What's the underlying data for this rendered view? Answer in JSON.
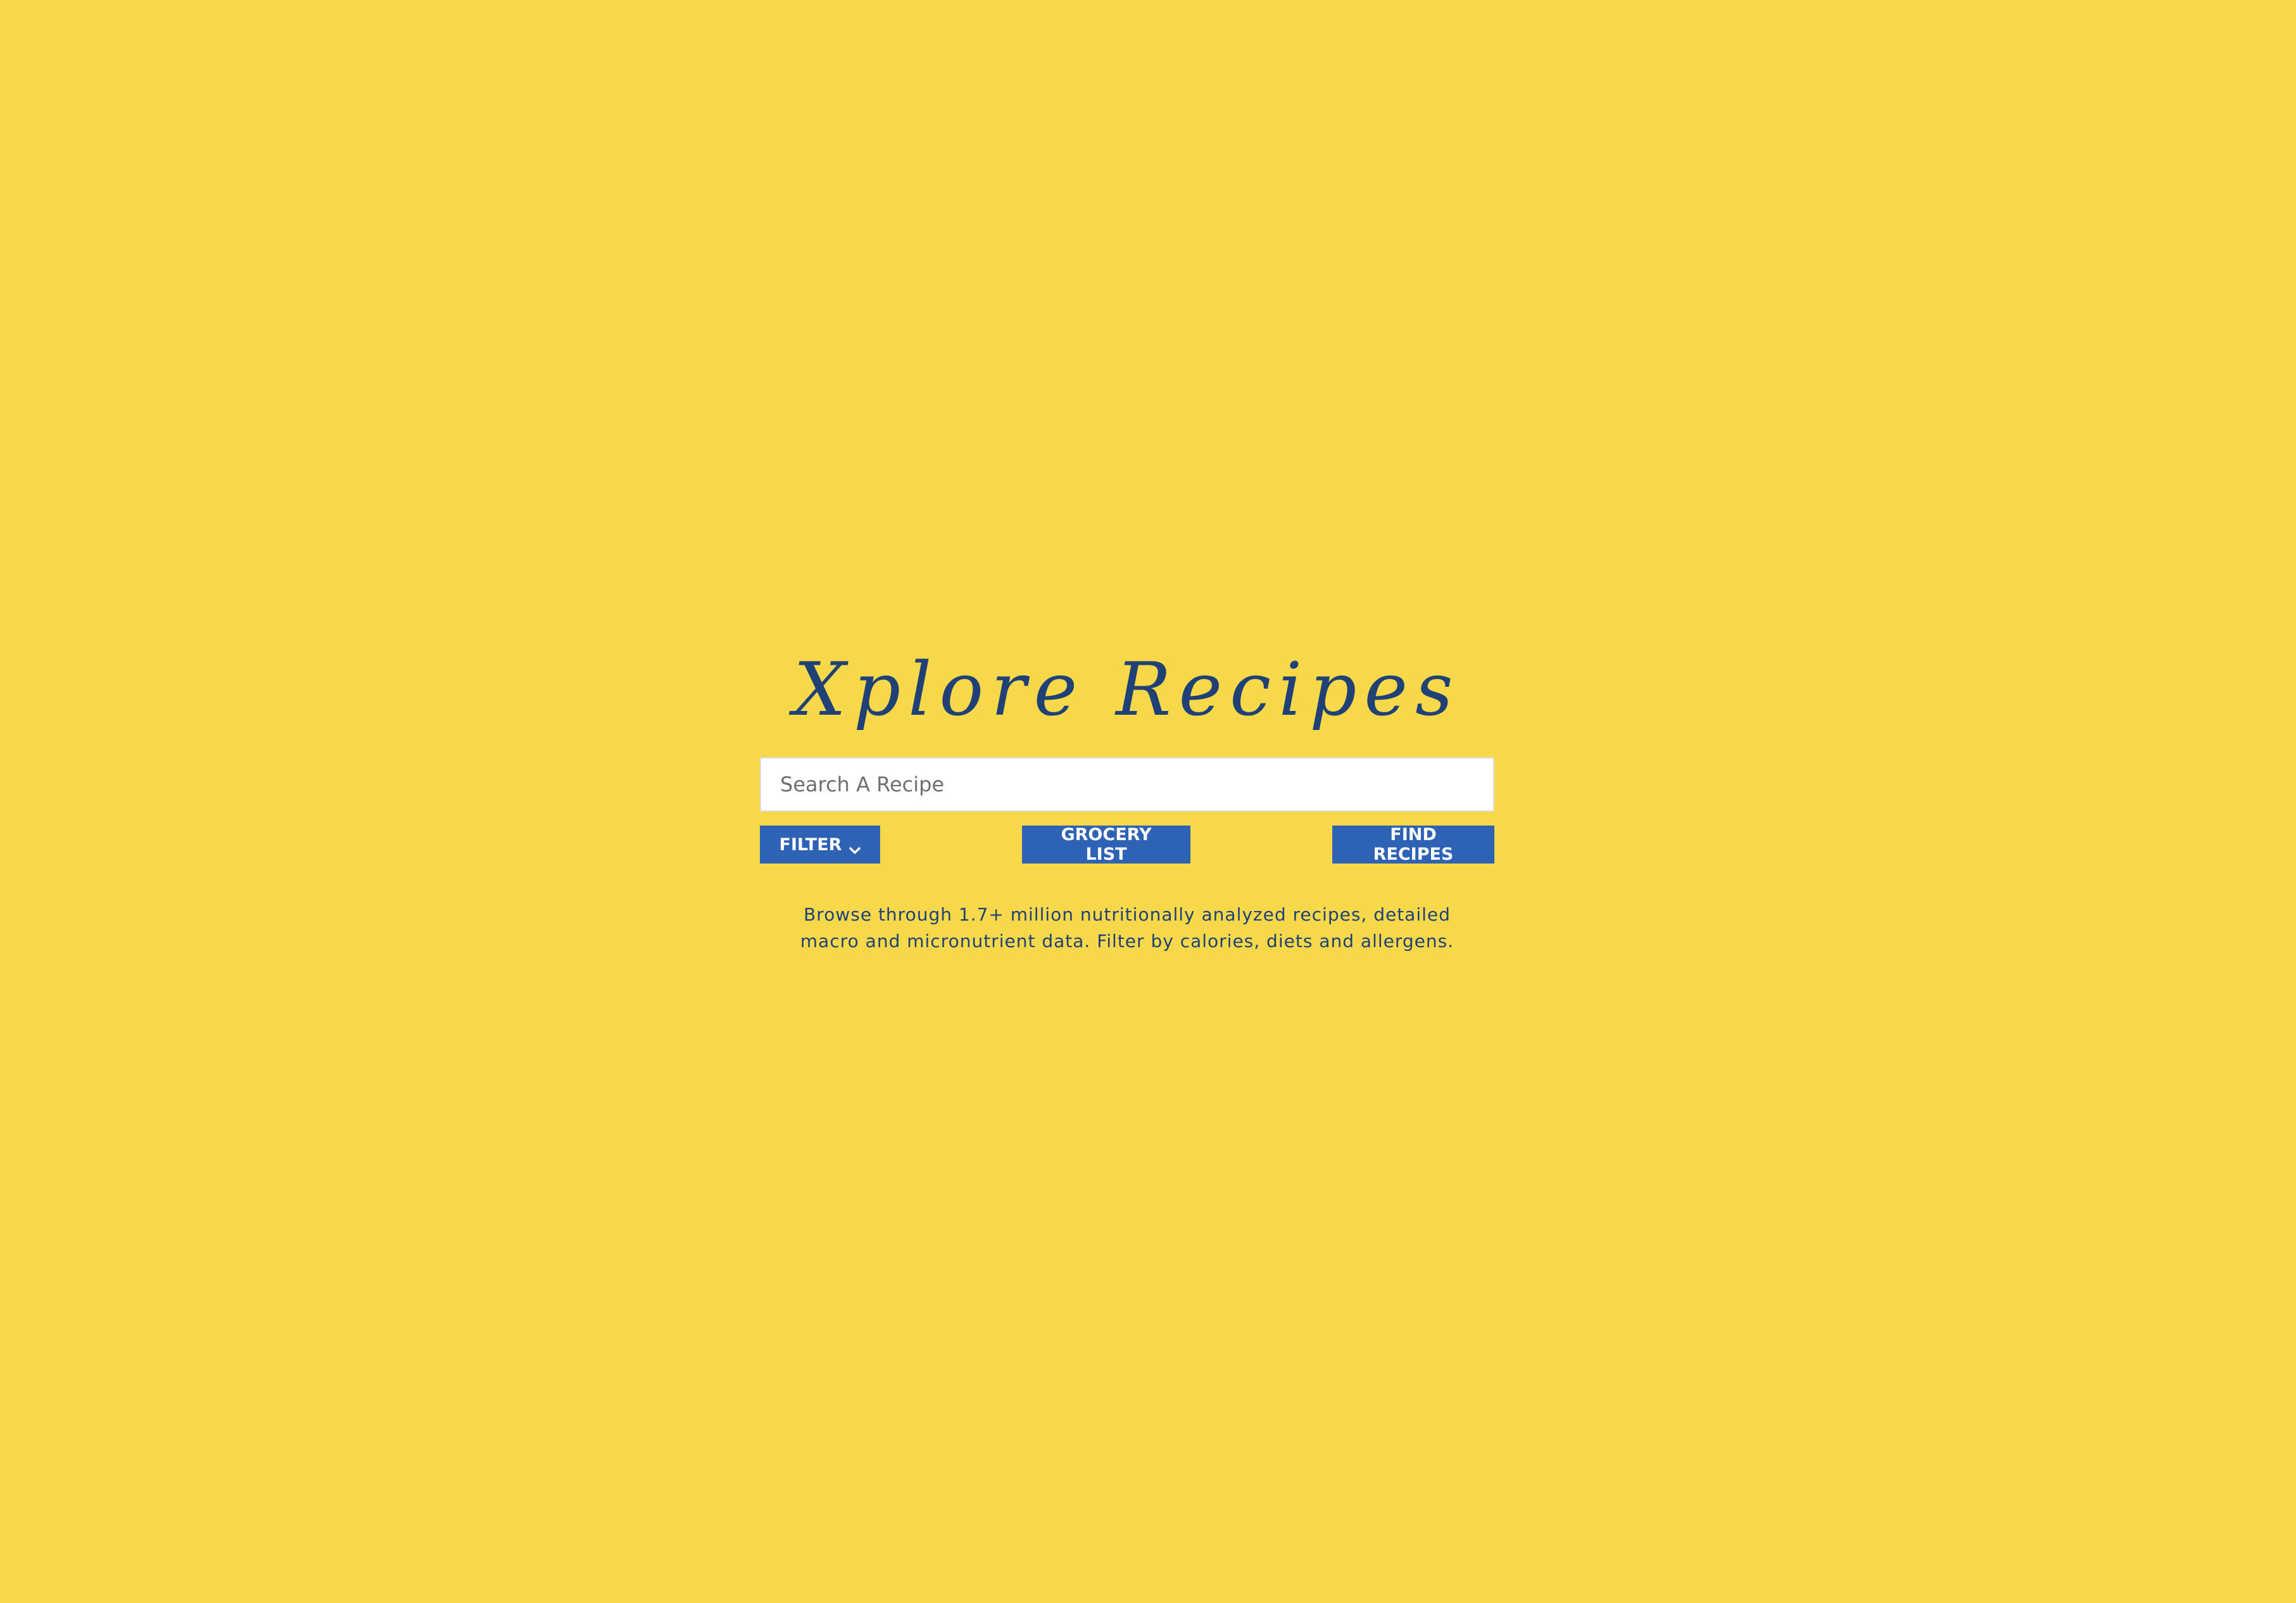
{
  "hero": {
    "title": "Xplore Recipes",
    "search": {
      "placeholder": "Search A Recipe",
      "value": ""
    },
    "buttons": {
      "filter": "FILTER",
      "filter_icon": "chevron-down-icon",
      "grocery_list": "GROCERY LIST",
      "find_recipes": "FIND RECIPES"
    },
    "description": "Browse through 1.7+ million nutritionally analyzed recipes, detailed macro and micronutrient data. Filter by calories, diets and allergens."
  },
  "colors": {
    "background": "#f7d84b",
    "title": "#1f4175",
    "button": "#2d62b5",
    "button_text": "#ffffff"
  }
}
